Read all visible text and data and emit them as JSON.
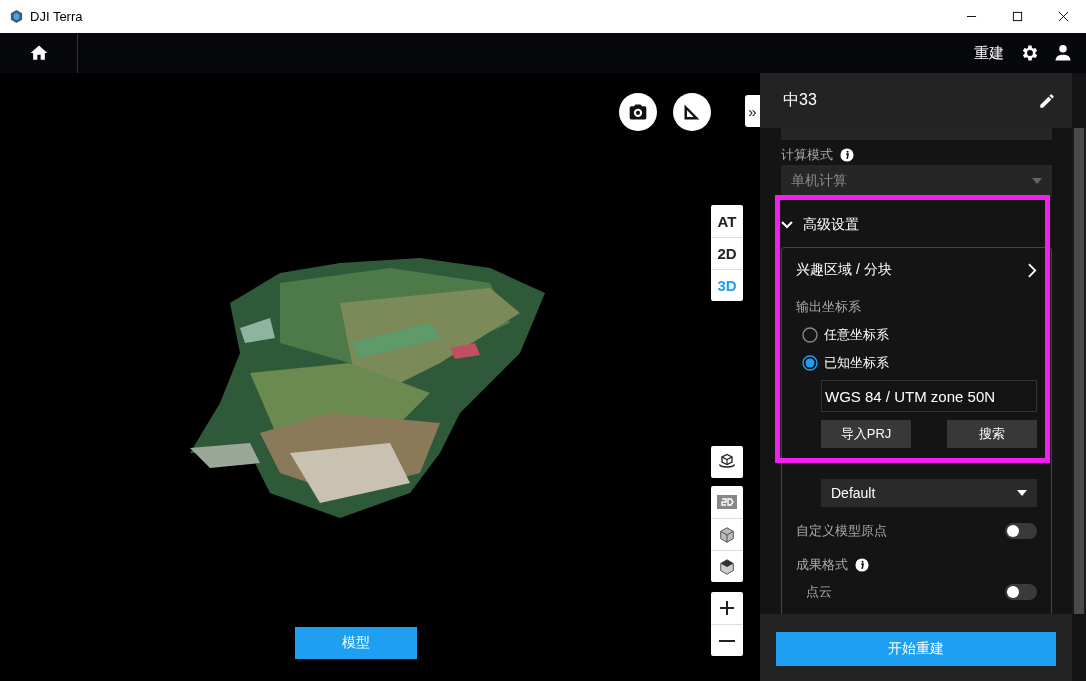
{
  "window": {
    "title": "DJI Terra"
  },
  "nav": {
    "action": "重建"
  },
  "viewport": {
    "collapse": "»",
    "view_modes": [
      {
        "label": "AT",
        "selected": false
      },
      {
        "label": "2D",
        "selected": false
      },
      {
        "label": "3D",
        "selected": true
      }
    ],
    "model_button": "模型"
  },
  "panel": {
    "title": "中33",
    "compute_mode": {
      "label": "计算模式",
      "value": "单机计算",
      "disabled": true
    },
    "advanced": {
      "label": "高级设置",
      "expanded": true,
      "region_link": "兴趣区域 / 分块",
      "output_crs": {
        "label": "输出坐标系",
        "options": [
          {
            "label": "任意坐标系",
            "selected": false
          },
          {
            "label": "已知坐标系",
            "selected": true
          }
        ],
        "value": "WGS 84 / UTM zone 50N",
        "buttons": [
          "导入PRJ",
          "搜索"
        ]
      },
      "elevation": {
        "value": "Default"
      },
      "custom_origin": {
        "label": "自定义模型原点",
        "on": false
      },
      "output_format": {
        "label": "成果格式",
        "items": [
          {
            "label": "点云",
            "on": false
          }
        ]
      }
    },
    "start_button": "开始重建"
  }
}
